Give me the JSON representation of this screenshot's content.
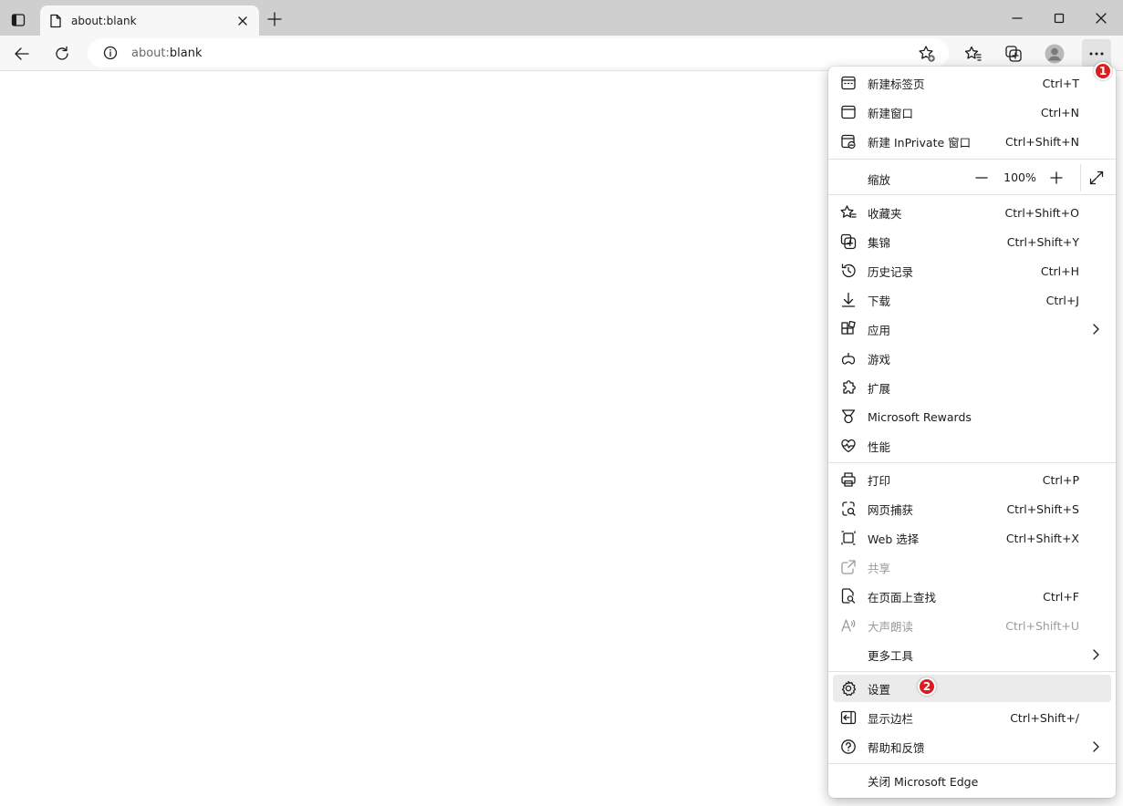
{
  "tab": {
    "title": "about:blank"
  },
  "address_bar": {
    "url_prefix": "about:",
    "url_host": "blank"
  },
  "badges": {
    "first": "1",
    "second": "2"
  },
  "zoom": {
    "label": "缩放",
    "value": "100%"
  },
  "menu": {
    "group1": [
      {
        "label": "新建标签页",
        "shortcut": "Ctrl+T",
        "icon": "new-tab-icon"
      },
      {
        "label": "新建窗口",
        "shortcut": "Ctrl+N",
        "icon": "new-window-icon"
      },
      {
        "label": "新建 InPrivate 窗口",
        "shortcut": "Ctrl+Shift+N",
        "icon": "inprivate-icon"
      }
    ],
    "group2": [
      {
        "label": "收藏夹",
        "shortcut": "Ctrl+Shift+O",
        "icon": "favorites-icon"
      },
      {
        "label": "集锦",
        "shortcut": "Ctrl+Shift+Y",
        "icon": "collections-icon"
      },
      {
        "label": "历史记录",
        "shortcut": "Ctrl+H",
        "icon": "history-icon"
      },
      {
        "label": "下载",
        "shortcut": "Ctrl+J",
        "icon": "download-icon"
      },
      {
        "label": "应用",
        "shortcut": "",
        "icon": "apps-icon"
      },
      {
        "label": "游戏",
        "shortcut": "",
        "icon": "games-icon"
      },
      {
        "label": "扩展",
        "shortcut": "",
        "icon": "extensions-icon"
      },
      {
        "label": "Microsoft Rewards",
        "shortcut": "",
        "icon": "rewards-icon"
      },
      {
        "label": "性能",
        "shortcut": "",
        "icon": "performance-icon"
      }
    ],
    "group3": [
      {
        "label": "打印",
        "shortcut": "Ctrl+P",
        "icon": "print-icon"
      },
      {
        "label": "网页捕获",
        "shortcut": "Ctrl+Shift+S",
        "icon": "web-capture-icon"
      },
      {
        "label": "Web 选择",
        "shortcut": "Ctrl+Shift+X",
        "icon": "web-select-icon"
      },
      {
        "label": "共享",
        "shortcut": "",
        "icon": "share-icon"
      },
      {
        "label": "在页面上查找",
        "shortcut": "Ctrl+F",
        "icon": "find-icon"
      },
      {
        "label": "大声朗读",
        "shortcut": "Ctrl+Shift+U",
        "icon": "read-aloud-icon"
      },
      {
        "label": "更多工具",
        "shortcut": "",
        "icon": ""
      }
    ],
    "group4": [
      {
        "label": "设置",
        "shortcut": "",
        "icon": "settings-icon"
      },
      {
        "label": "显示边栏",
        "shortcut": "Ctrl+Shift+/",
        "icon": "sidebar-icon"
      },
      {
        "label": "帮助和反馈",
        "shortcut": "",
        "icon": "help-icon"
      }
    ],
    "close": {
      "label": "关闭 Microsoft Edge"
    }
  }
}
